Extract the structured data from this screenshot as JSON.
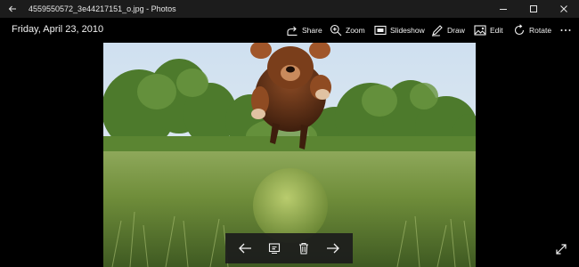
{
  "window": {
    "title": "4559550572_3e44217151_o.jpg - Photos"
  },
  "commandbar": {
    "date": "Friday, April 23, 2010",
    "commands": {
      "share": {
        "label": "Share",
        "icon": "share-icon"
      },
      "zoom": {
        "label": "Zoom",
        "icon": "zoom-icon"
      },
      "slideshow": {
        "label": "Slideshow",
        "icon": "slideshow-icon"
      },
      "draw": {
        "label": "Draw",
        "icon": "pen-icon"
      },
      "edit": {
        "label": "Edit",
        "icon": "edit-image-icon"
      },
      "rotate": {
        "label": "Rotate",
        "icon": "rotate-icon"
      },
      "more": {
        "icon": "more-icon"
      }
    }
  },
  "navigation": {
    "buttons": [
      "arrow-left-icon",
      "presentation-icon",
      "trash-icon",
      "arrow-right-icon"
    ]
  },
  "colors": {
    "background": "#000000",
    "titlebar": "#1c1c1c",
    "text": "#f2f2f2"
  }
}
